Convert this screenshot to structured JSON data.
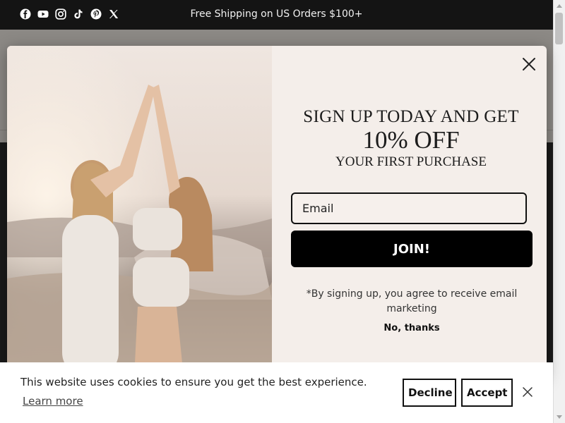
{
  "announcement": {
    "text": "Free Shipping on US Orders $100+",
    "social_icons": [
      "facebook-icon",
      "youtube-icon",
      "instagram-icon",
      "tiktok-icon",
      "pinterest-icon",
      "x-icon"
    ]
  },
  "popup": {
    "headline_line1": "SIGN UP TODAY AND GET",
    "headline_line2": "10% OFF",
    "headline_line3": "YOUR FIRST PURCHASE",
    "email_placeholder": "Email",
    "join_label": "JOIN!",
    "disclaimer": "*By signing up, you agree to receive email marketing",
    "no_thanks": "No, thanks"
  },
  "cookie_banner": {
    "text": "This website uses cookies to ensure you get the best experience.",
    "learn_more": "Learn more",
    "decline_label": "Decline",
    "accept_label": "Accept"
  },
  "colors": {
    "announcement_bg": "#141414",
    "popup_bg": "#f4eeea",
    "button_bg": "#000000"
  }
}
